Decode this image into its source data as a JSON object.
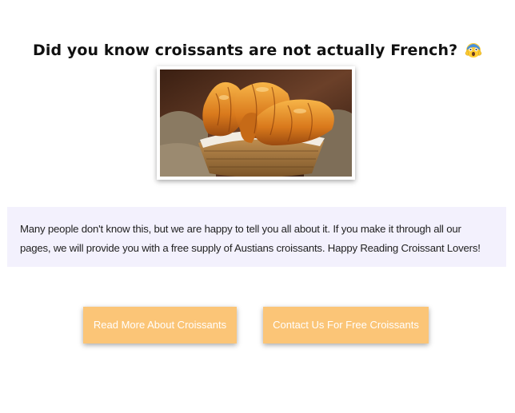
{
  "heading": {
    "text": "Did you know croissants are not actually French?",
    "emoji_icon": "screaming-face-emoji"
  },
  "photo": {
    "subject": "croissants-in-wicker-basket-image"
  },
  "intro": {
    "text": "Many people don't know this, but we are happy to tell you all about it. If you make it through all our pages, we will provide you with a free supply of Austians croissants. Happy Reading Croissant Lovers!"
  },
  "buttons": {
    "read_more_label": "Read More About Croissants",
    "contact_label": "Contact Us For Free Croissants"
  },
  "colors": {
    "button_bg": "#fbc577",
    "intro_bg": "#f3f1fd",
    "text": "#111111"
  }
}
